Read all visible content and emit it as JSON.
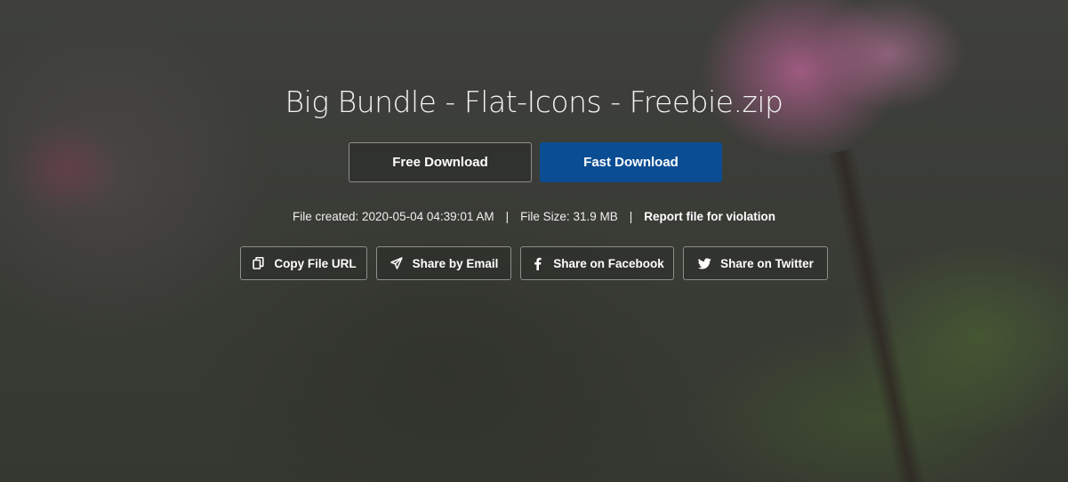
{
  "page": {
    "title": "Big Bundle - Flat-Icons - Freebie.zip"
  },
  "download": {
    "free_label": "Free Download",
    "fast_label": "Fast Download",
    "fast_color": "#0b4d93"
  },
  "file_info": {
    "created": "File created: 2020-05-04 04:39:01 AM",
    "separator": "|",
    "size": "File Size: 31.9 MB",
    "report_label": "Report file for violation"
  },
  "share": {
    "copy_label": "Copy File URL",
    "copy_icon": "copy-icon",
    "email_label": "Share by Email",
    "email_icon": "paper-plane-icon",
    "facebook_label": "Share on Facebook",
    "facebook_icon": "facebook-icon",
    "twitter_label": "Share on Twitter",
    "twitter_icon": "twitter-icon"
  }
}
